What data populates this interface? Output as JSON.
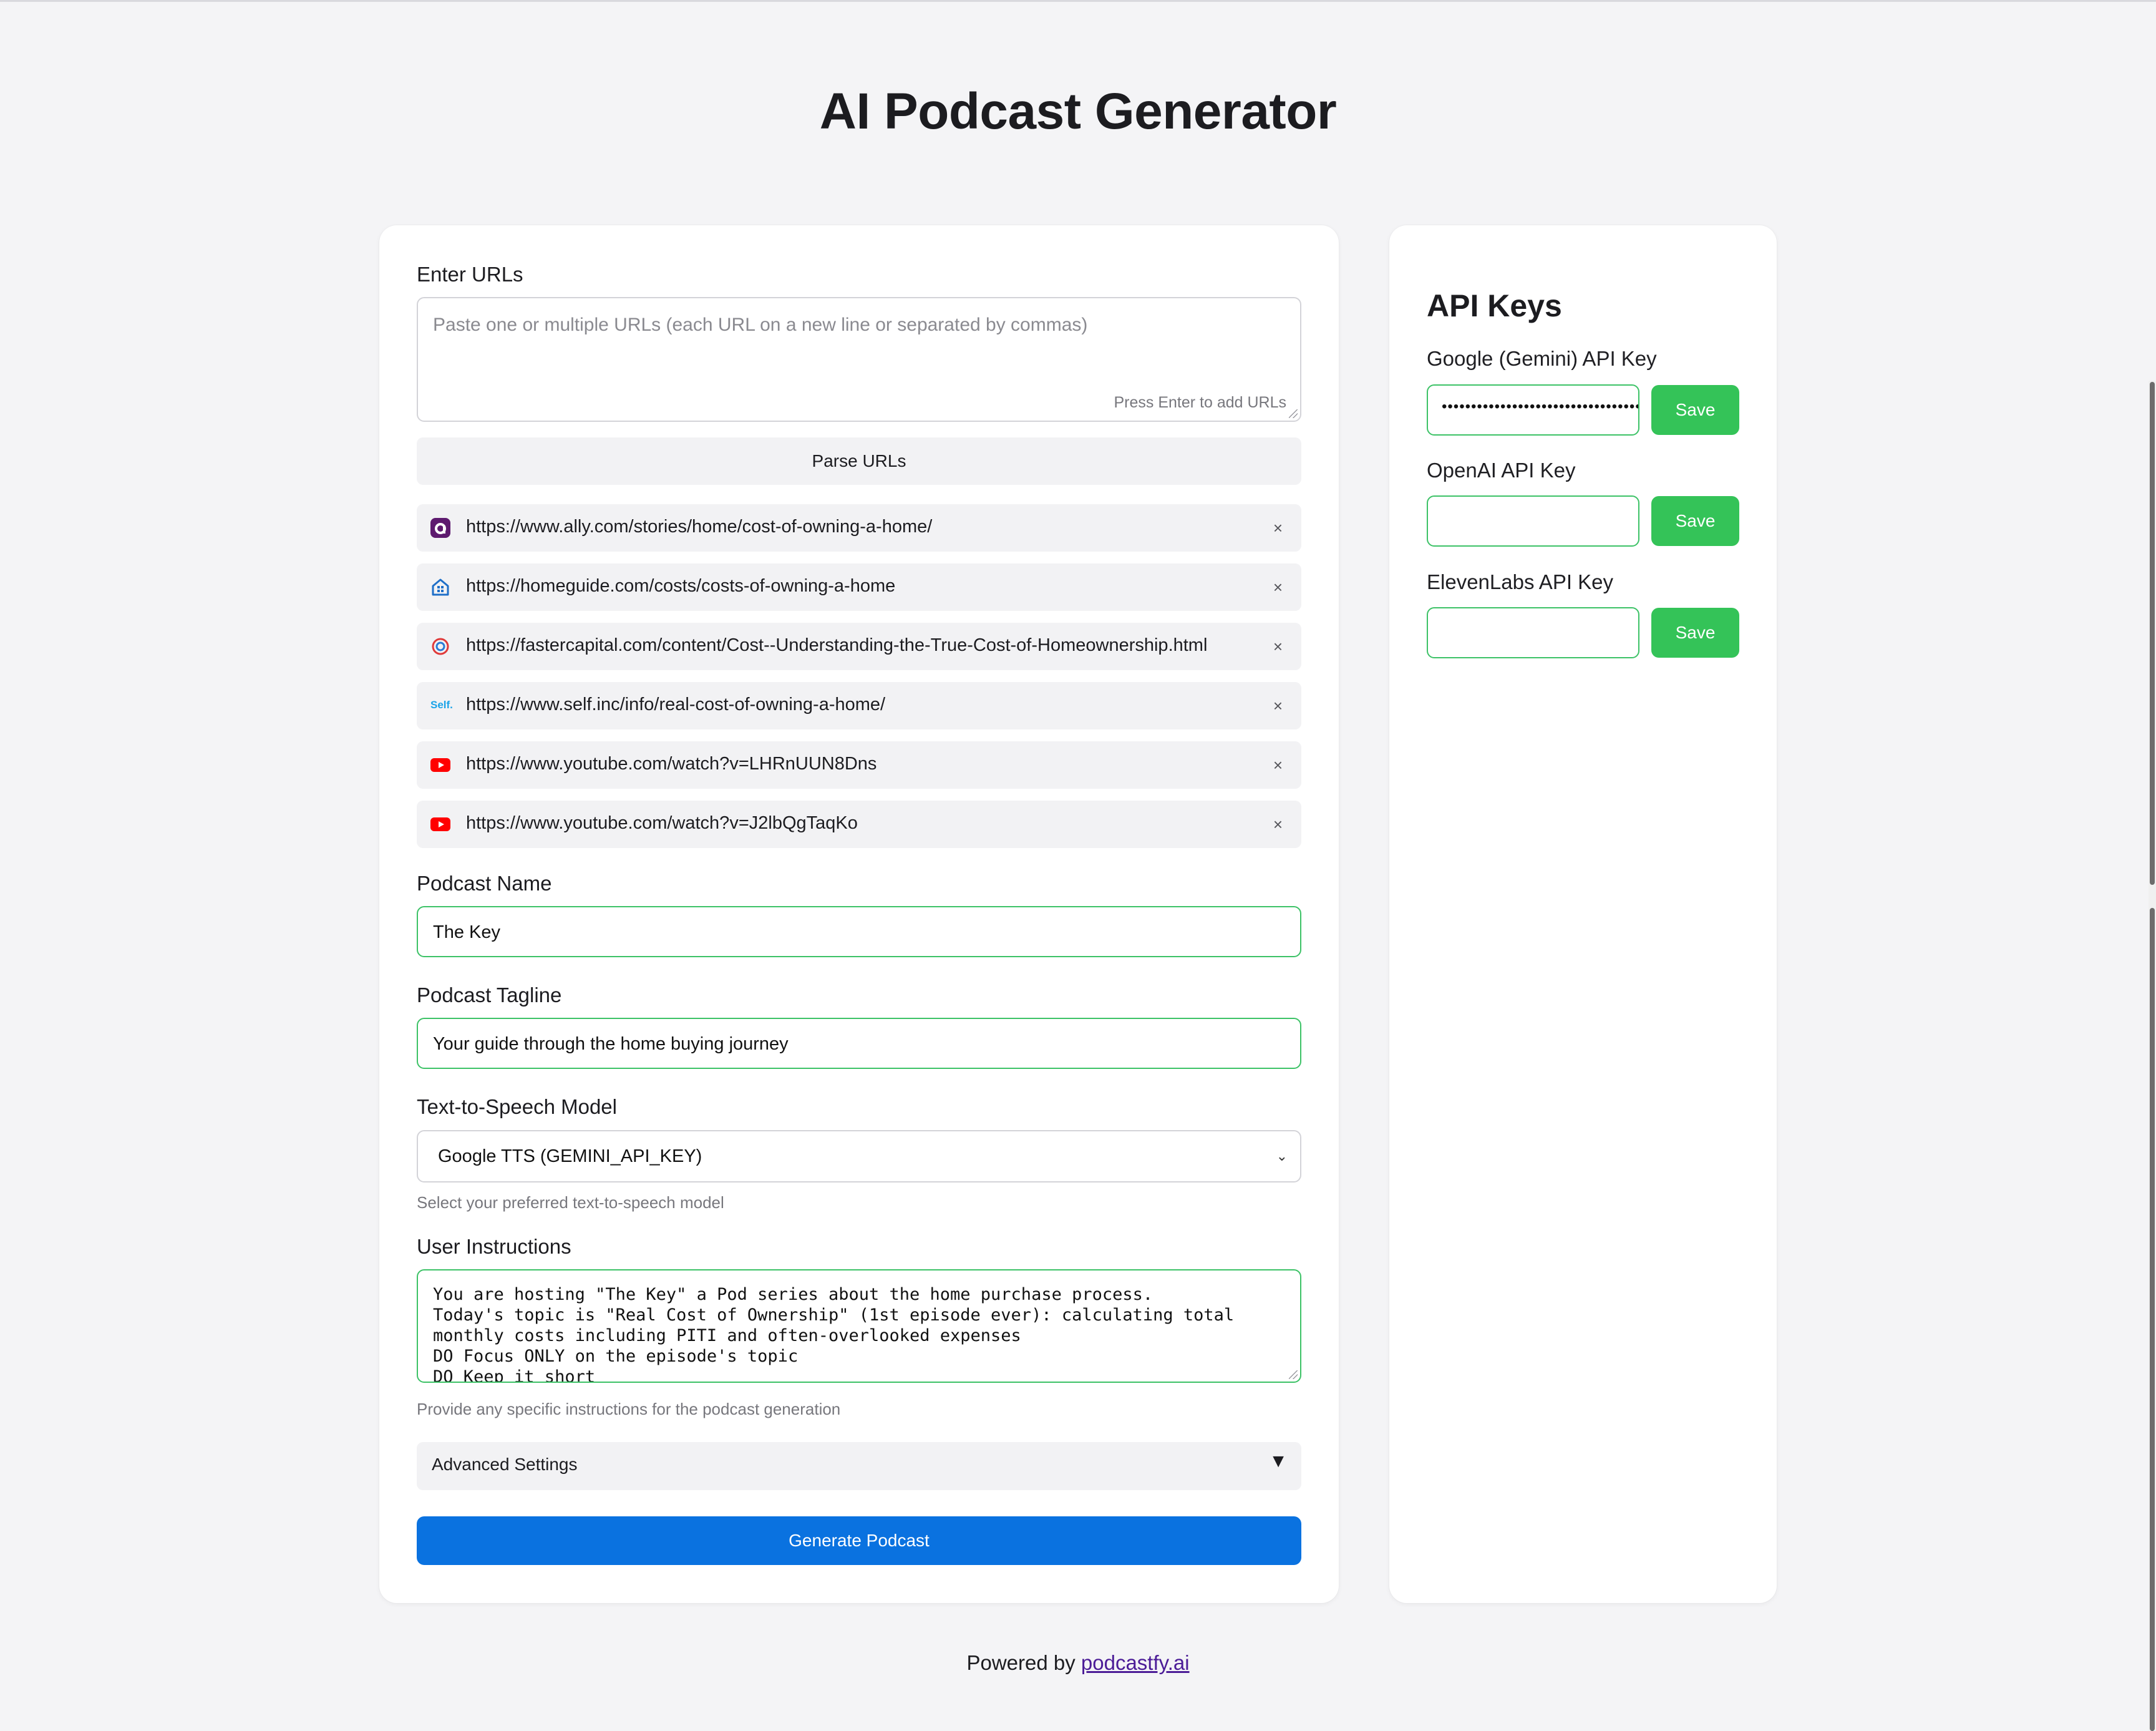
{
  "page": {
    "title": "AI Podcast Generator"
  },
  "urls": {
    "label": "Enter URLs",
    "placeholder": "Paste one or multiple URLs (each URL on a new line or separated by commas)",
    "hint": "Press Enter to add URLs",
    "parse_button": "Parse URLs",
    "remove_symbol": "×",
    "items": [
      {
        "url": "https://www.ally.com/stories/home/cost-of-owning-a-home/",
        "icon": "ally-favicon-icon"
      },
      {
        "url": "https://homeguide.com/costs/costs-of-owning-a-home",
        "icon": "homeguide-favicon-icon"
      },
      {
        "url": "https://fastercapital.com/content/Cost--Understanding-the-True-Cost-of-Homeownership.html",
        "icon": "fastercapital-favicon-icon"
      },
      {
        "url": "https://www.self.inc/info/real-cost-of-owning-a-home/",
        "icon": "self-favicon-icon",
        "icon_text": "Self."
      },
      {
        "url": "https://www.youtube.com/watch?v=LHRnUUN8Dns",
        "icon": "youtube-icon"
      },
      {
        "url": "https://www.youtube.com/watch?v=J2lbQgTaqKo",
        "icon": "youtube-icon"
      }
    ]
  },
  "podcast_name": {
    "label": "Podcast Name",
    "value": "The Key"
  },
  "podcast_tagline": {
    "label": "Podcast Tagline",
    "value": "Your guide through the home buying journey"
  },
  "tts": {
    "label": "Text-to-Speech Model",
    "selected": "Google TTS (GEMINI_API_KEY)",
    "hint": "Select your preferred text-to-speech model"
  },
  "instructions": {
    "label": "User Instructions",
    "lines": [
      "You are hosting \"The Key\" a Pod series about the home purchase process.",
      "Today's topic is \"Real Cost of Ownership\" (1st episode ever): calculating total",
      "monthly costs including PITI and often-overlooked expenses",
      "DO Focus ONLY on the episode's topic",
      "DO Keep it short"
    ],
    "hint": "Provide any specific instructions for the podcast generation"
  },
  "advanced": {
    "label": "Advanced Settings",
    "arrow": "▼"
  },
  "generate_button": "Generate Podcast",
  "api_keys": {
    "title": "API Keys",
    "save_label": "Save",
    "keys": [
      {
        "label": "Google (Gemini) API Key",
        "value": "••••••••••••••••••••••••••••••••••••"
      },
      {
        "label": "OpenAI API Key",
        "value": ""
      },
      {
        "label": "ElevenLabs API Key",
        "value": ""
      }
    ]
  },
  "footer": {
    "prefix": "Powered by",
    "link": "podcastfy.ai"
  },
  "colors": {
    "accent_blue": "#0a72e0",
    "accent_green": "#34c358",
    "link_purple": "#4b1c97",
    "background": "#f4f4f6"
  }
}
